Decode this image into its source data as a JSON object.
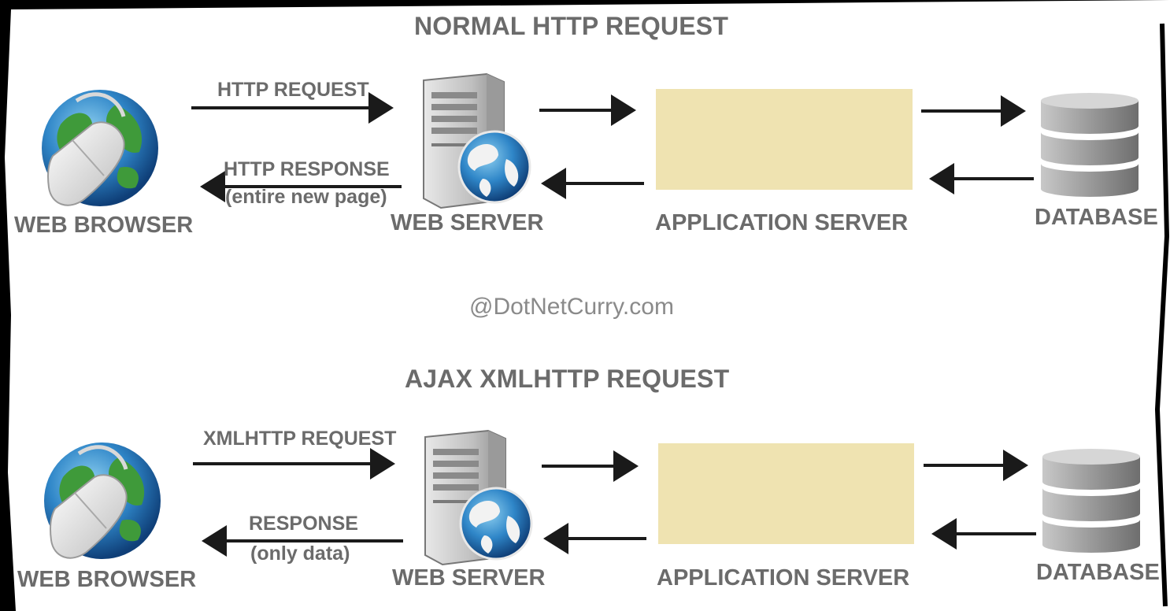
{
  "watermark": "@DotNetCurry.com",
  "colors": {
    "app_box": "#efe3b1",
    "text": "#6b6b6b",
    "arrow": "#1a1a1a"
  },
  "sections": [
    {
      "title": "NORMAL HTTP REQUEST",
      "request_label": "HTTP REQUEST",
      "response_label": "HTTP RESPONSE",
      "response_sublabel": "(entire new page)",
      "browser_label": "WEB BROWSER",
      "webserver_label": "WEB SERVER",
      "appserver_label": "APPLICATION SERVER",
      "database_label": "DATABASE"
    },
    {
      "title": "AJAX XMLHTTP REQUEST",
      "request_label": "XMLHTTP REQUEST",
      "response_label": "RESPONSE",
      "response_sublabel": "(only data)",
      "browser_label": "WEB BROWSER",
      "webserver_label": "WEB SERVER",
      "appserver_label": "APPLICATION SERVER",
      "database_label": "DATABASE"
    }
  ]
}
